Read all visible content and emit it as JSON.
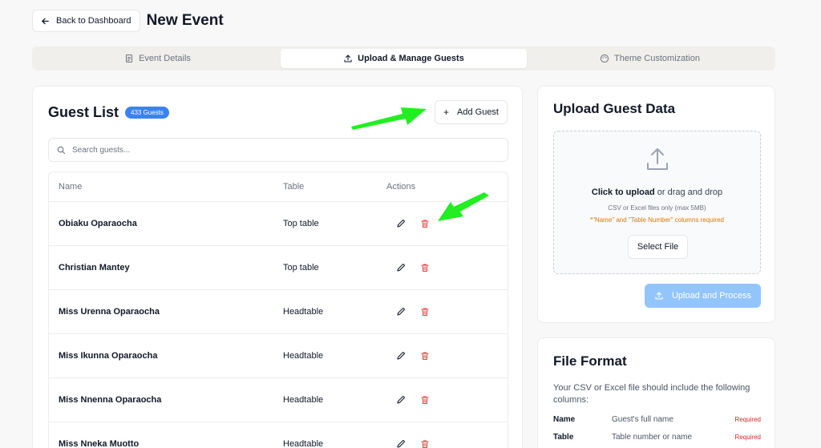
{
  "header": {
    "back_label": "Back to Dashboard",
    "title": "New Event"
  },
  "tabs": [
    {
      "label": "Event Details",
      "icon": "document-icon",
      "active": false
    },
    {
      "label": "Upload & Manage Guests",
      "icon": "upload-icon",
      "active": true
    },
    {
      "label": "Theme Customization",
      "icon": "palette-icon",
      "active": false
    }
  ],
  "guest_list": {
    "title": "Guest List",
    "count_badge": "433 Guests",
    "add_label": "Add Guest",
    "search_placeholder": "Search guests...",
    "columns": [
      "Name",
      "Table",
      "Actions"
    ],
    "rows": [
      {
        "name": "Obiaku Oparaocha",
        "table": "Top table"
      },
      {
        "name": "Christian Mantey",
        "table": "Top table"
      },
      {
        "name": "Miss Urenna Oparaocha",
        "table": "Headtable"
      },
      {
        "name": "Miss Ikunna Oparaocha",
        "table": "Headtable"
      },
      {
        "name": "Miss Nnenna Oparaocha",
        "table": "Headtable"
      },
      {
        "name": "Miss Nneka Muotto",
        "table": "Headtable"
      }
    ]
  },
  "upload": {
    "title": "Upload Guest Data",
    "click_label": "Click to upload",
    "drag_label": " or drag and drop",
    "file_hint": "CSV or Excel files only (max 5MB)",
    "required_note": "*\"Name\" and \"Table Number\" columns required",
    "select_label": "Select File",
    "process_label": "Upload and Process"
  },
  "file_format": {
    "title": "File Format",
    "description": "Your CSV or Excel file should include the following columns:",
    "fields": [
      {
        "key": "Name",
        "desc": "Guest's full name",
        "req": "Required"
      },
      {
        "key": "Table",
        "desc": "Table number or name",
        "req": "Required"
      }
    ]
  },
  "colors": {
    "accent": "#3b82f6",
    "danger": "#ef4444",
    "annotation_arrow": "#22ee22"
  }
}
